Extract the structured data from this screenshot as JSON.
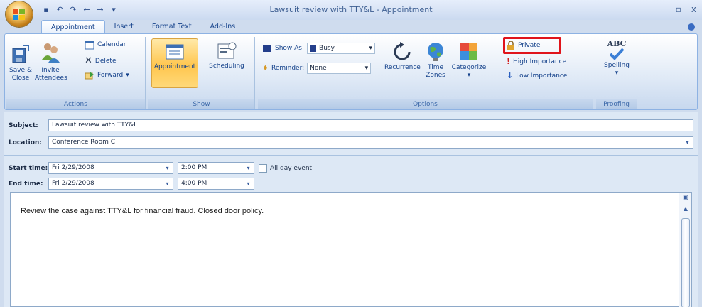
{
  "window": {
    "title": "Lawsuit review with TTY&L - Appointment",
    "controls": [
      "_",
      "▫",
      "x"
    ]
  },
  "tabs": [
    {
      "label": "Appointment",
      "active": true
    },
    {
      "label": "Insert"
    },
    {
      "label": "Format Text"
    },
    {
      "label": "Add-Ins"
    }
  ],
  "ribbon": {
    "actions": {
      "group_label": "Actions",
      "save_close": [
        "Save &",
        "Close"
      ],
      "invite": [
        "Invite",
        "Attendees"
      ],
      "calendar": "Calendar",
      "delete": "Delete",
      "forward": "Forward"
    },
    "show": {
      "group_label": "Show",
      "appointment": "Appointment",
      "scheduling": "Scheduling"
    },
    "options": {
      "group_label": "Options",
      "show_as_label": "Show As:",
      "show_as_value": "Busy",
      "reminder_label": "Reminder:",
      "reminder_value": "None",
      "recurrence": "Recurrence",
      "time_zones": [
        "Time",
        "Zones"
      ],
      "categorize": "Categorize",
      "private": "Private",
      "high_importance": "High Importance",
      "low_importance": "Low Importance"
    },
    "proofing": {
      "group_label": "Proofing",
      "abc": "ABC",
      "spelling": "Spelling"
    }
  },
  "form": {
    "subject_label": "Subject:",
    "subject_value": "Lawsuit review with TTY&L",
    "location_label": "Location:",
    "location_value": "Conference Room C",
    "start_label": "Start time:",
    "start_date": "Fri 2/29/2008",
    "start_time": "2:00 PM",
    "all_day_label": "All day event",
    "end_label": "End time:",
    "end_date": "Fri 2/29/2008",
    "end_time": "4:00 PM",
    "body": "Review the case against TTY&L for financial fraud. Closed door policy."
  },
  "colors": {
    "accent": "#15428b",
    "highlight": "#e0141b"
  }
}
